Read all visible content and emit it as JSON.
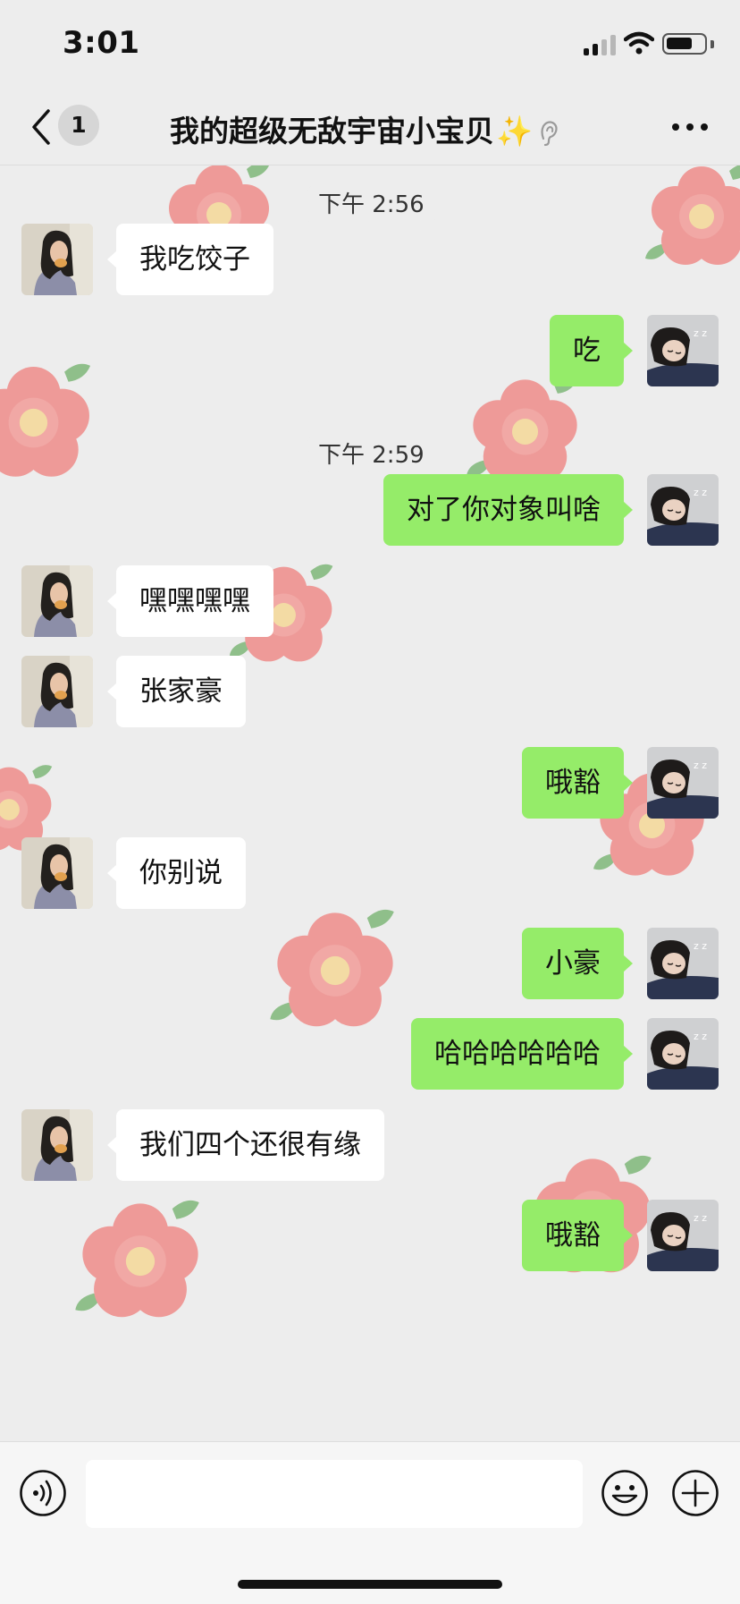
{
  "status_bar": {
    "time": "3:01"
  },
  "nav": {
    "back_icon": "chevron-left-icon",
    "unread_count": "1",
    "title": "我的超级无敌宇宙小宝贝",
    "title_emoji": "✨",
    "mute_icon": "ear-muted-icon",
    "more_icon": "more-dots-icon"
  },
  "messages": [
    {
      "type": "time",
      "text": "下午 2:56"
    },
    {
      "type": "msg",
      "side": "in",
      "text": "我吃饺子"
    },
    {
      "type": "msg",
      "side": "out",
      "text": "吃"
    },
    {
      "type": "time",
      "text": "下午 2:59"
    },
    {
      "type": "msg",
      "side": "out",
      "text": "对了你对象叫啥"
    },
    {
      "type": "msg",
      "side": "in",
      "text": "嘿嘿嘿嘿"
    },
    {
      "type": "msg",
      "side": "in",
      "text": "张家豪"
    },
    {
      "type": "msg",
      "side": "out",
      "text": "哦豁"
    },
    {
      "type": "msg",
      "side": "in",
      "text": "你别说"
    },
    {
      "type": "msg",
      "side": "out",
      "text": "小豪"
    },
    {
      "type": "msg",
      "side": "out",
      "text": "哈哈哈哈哈哈"
    },
    {
      "type": "msg",
      "side": "in",
      "text": "我们四个还很有缘"
    },
    {
      "type": "msg",
      "side": "out",
      "text": "哦豁"
    }
  ],
  "input_bar": {
    "voice_icon": "voice-icon",
    "input_value": "",
    "emoji_icon": "emoji-icon",
    "plus_icon": "plus-circle-icon"
  },
  "colors": {
    "background": "#ededed",
    "outgoing_bubble": "#95ec69",
    "incoming_bubble": "#ffffff",
    "flower_petal": "#ee9a98",
    "flower_center": "#f3dba4",
    "flower_leaf": "#8fbf8a"
  }
}
